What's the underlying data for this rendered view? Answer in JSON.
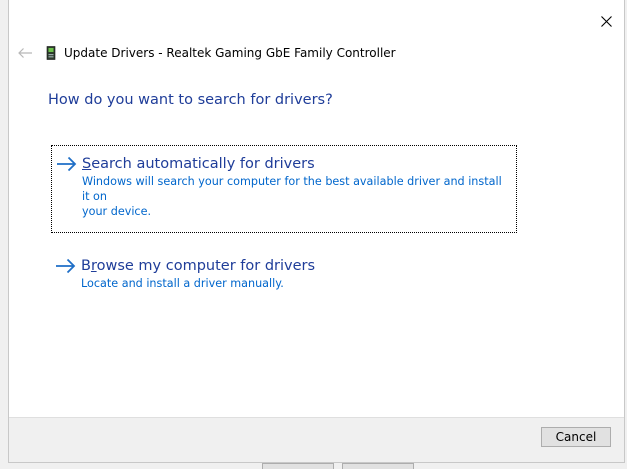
{
  "window": {
    "title": "Update Drivers - Realtek Gaming GbE Family Controller"
  },
  "heading": "How do you want to search for drivers?",
  "options": [
    {
      "accel": "S",
      "title_rest": "earch automatically for drivers",
      "description_line1": "Windows will search your computer for the best available driver and install it on",
      "description_line2": "your device."
    },
    {
      "title_pre": "B",
      "accel": "r",
      "title_rest": "owse my computer for drivers",
      "description_line1": "Locate and install a driver manually."
    }
  ],
  "footer": {
    "cancel_label": "Cancel"
  },
  "colors": {
    "heading": "#1f3d99",
    "link_desc": "#0066cc",
    "arrow": "#1f6fc7"
  },
  "icons": {
    "back": "back-arrow-icon",
    "device": "network-adapter-icon",
    "close": "close-icon",
    "option": "right-arrow-icon"
  }
}
